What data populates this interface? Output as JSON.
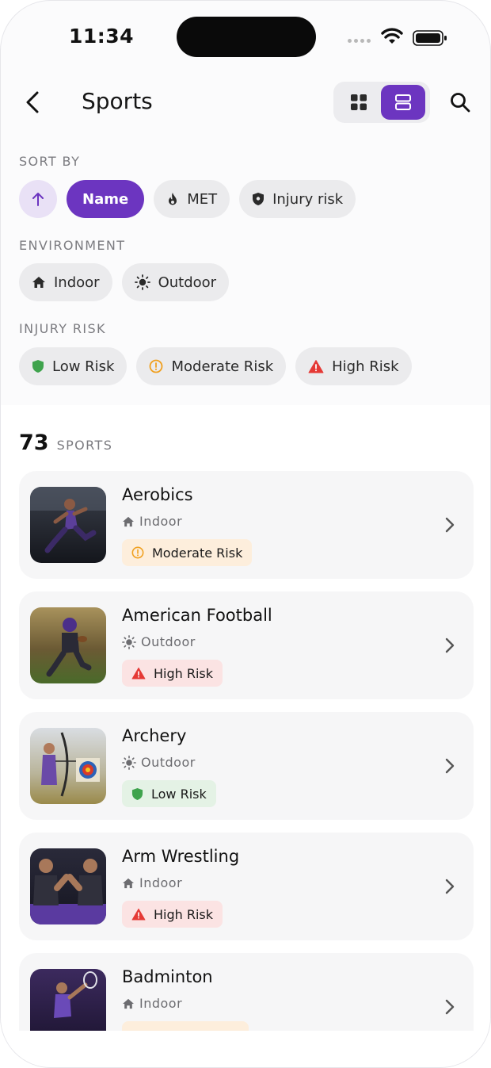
{
  "status_bar": {
    "time": "11:34"
  },
  "header": {
    "title": "Sports"
  },
  "filters": {
    "sort_by": {
      "label": "SORT BY",
      "options": [
        {
          "label": "Name",
          "icon": "sort-name",
          "active": true
        },
        {
          "label": "MET",
          "icon": "flame-icon",
          "active": false
        },
        {
          "label": "Injury risk",
          "icon": "shield-icon",
          "active": false
        }
      ]
    },
    "environment": {
      "label": "ENVIRONMENT",
      "options": [
        {
          "label": "Indoor",
          "icon": "home-icon"
        },
        {
          "label": "Outdoor",
          "icon": "sun-icon"
        }
      ]
    },
    "injury_risk": {
      "label": "INJURY RISK",
      "options": [
        {
          "label": "Low Risk",
          "icon": "shield-green-icon"
        },
        {
          "label": "Moderate Risk",
          "icon": "warning-circle-icon"
        },
        {
          "label": "High Risk",
          "icon": "warning-triangle-icon"
        }
      ]
    }
  },
  "results": {
    "count": "73",
    "count_label": "SPORTS",
    "items": [
      {
        "name": "Aerobics",
        "environment": "Indoor",
        "env_icon": "home-icon",
        "risk": "Moderate Risk",
        "risk_level": "moderate"
      },
      {
        "name": "American Football",
        "environment": "Outdoor",
        "env_icon": "sun-icon",
        "risk": "High Risk",
        "risk_level": "high"
      },
      {
        "name": "Archery",
        "environment": "Outdoor",
        "env_icon": "sun-icon",
        "risk": "Low Risk",
        "risk_level": "low"
      },
      {
        "name": "Arm Wrestling",
        "environment": "Indoor",
        "env_icon": "home-icon",
        "risk": "High Risk",
        "risk_level": "high"
      },
      {
        "name": "Badminton",
        "environment": "Indoor",
        "env_icon": "home-icon",
        "risk": "",
        "risk_level": "moderate"
      }
    ]
  },
  "colors": {
    "accent": "#6c35c0",
    "risk_low": "#3fa34d",
    "risk_moderate": "#f0a020",
    "risk_high": "#e53935"
  }
}
